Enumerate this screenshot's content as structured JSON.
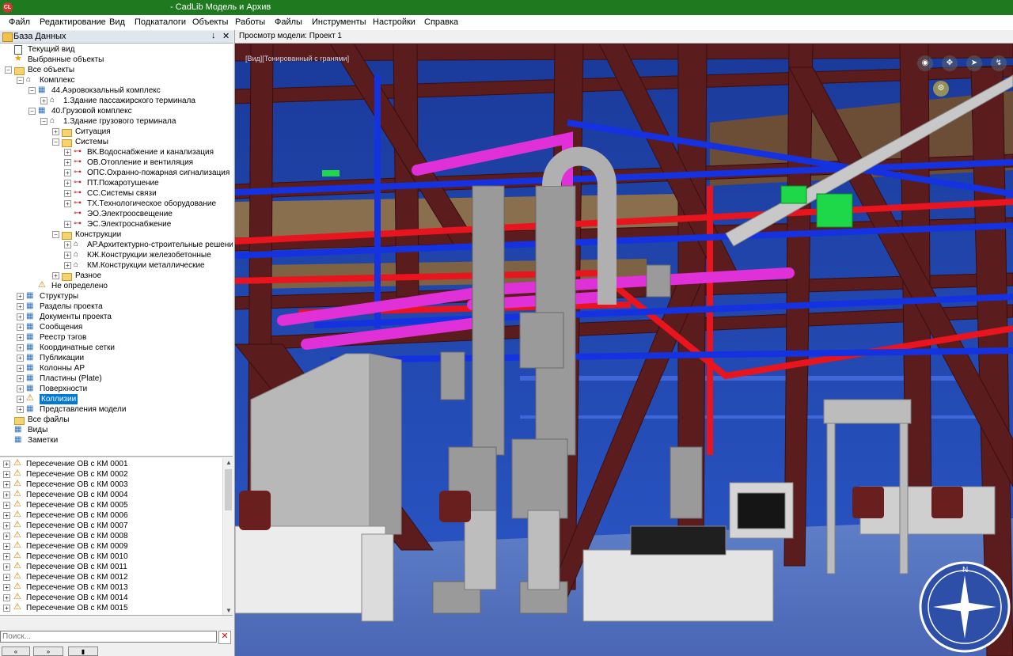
{
  "titlebar": {
    "icon_text": "CL",
    "title": "- CadLib Модель и Архив"
  },
  "menu": [
    "Файл",
    "Редактирование",
    "Вид",
    "Подкаталоги",
    "Объекты",
    "Работы",
    "Файлы",
    "Инструменты",
    "Настройки",
    "Справка"
  ],
  "panel": {
    "title": "База Данных",
    "pin": "↓",
    "close": "✕"
  },
  "tree": [
    {
      "label": "Текущий вид",
      "indent": 0,
      "expander": "",
      "icon": "doc"
    },
    {
      "label": "Выбранные объекты",
      "indent": 0,
      "expander": "",
      "icon": "star"
    },
    {
      "label": "Все объекты",
      "indent": 0,
      "expander": "−",
      "icon": "folder"
    },
    {
      "label": "Комплекс",
      "indent": 1,
      "expander": "−",
      "icon": "bld"
    },
    {
      "label": "44.Аэровокзальный комплекс",
      "indent": 2,
      "expander": "−",
      "icon": "gen"
    },
    {
      "label": "1.Здание пассажирского терминала",
      "indent": 3,
      "expander": "+",
      "icon": "bld"
    },
    {
      "label": "40.Грузовой комплекс",
      "indent": 2,
      "expander": "−",
      "icon": "gen"
    },
    {
      "label": "1.Здание грузового терминала",
      "indent": 3,
      "expander": "−",
      "icon": "bld"
    },
    {
      "label": "Ситуация",
      "indent": 4,
      "expander": "+",
      "icon": "folder"
    },
    {
      "label": "Системы",
      "indent": 4,
      "expander": "−",
      "icon": "folder"
    },
    {
      "label": "ВК.Водоснабжение и канализация",
      "indent": 5,
      "expander": "+",
      "icon": "sys"
    },
    {
      "label": "ОВ.Отопление и вентиляция",
      "indent": 5,
      "expander": "+",
      "icon": "sys"
    },
    {
      "label": "ОПС.Охранно-пожарная сигнализация",
      "indent": 5,
      "expander": "+",
      "icon": "sys"
    },
    {
      "label": "ПТ.Пожаротушение",
      "indent": 5,
      "expander": "+",
      "icon": "sys"
    },
    {
      "label": "СС.Системы связи",
      "indent": 5,
      "expander": "+",
      "icon": "sys"
    },
    {
      "label": "ТХ.Технологическое оборудование",
      "indent": 5,
      "expander": "+",
      "icon": "sys"
    },
    {
      "label": "ЭО.Электроосвещение",
      "indent": 5,
      "expander": "",
      "icon": "sys"
    },
    {
      "label": "ЭС.Электроснабжение",
      "indent": 5,
      "expander": "+",
      "icon": "sys"
    },
    {
      "label": "Конструкции",
      "indent": 4,
      "expander": "−",
      "icon": "folder"
    },
    {
      "label": "АР.Архитектурно-строительные решения",
      "indent": 5,
      "expander": "+",
      "icon": "bld"
    },
    {
      "label": "КЖ.Конструкции железобетонные",
      "indent": 5,
      "expander": "+",
      "icon": "bld"
    },
    {
      "label": "КМ.Конструкции металлические",
      "indent": 5,
      "expander": "+",
      "icon": "bld"
    },
    {
      "label": "Разное",
      "indent": 4,
      "expander": "+",
      "icon": "folder"
    },
    {
      "label": "Не определено",
      "indent": 2,
      "expander": "",
      "icon": "warn"
    },
    {
      "label": "Структуры",
      "indent": 1,
      "expander": "+",
      "icon": "gen"
    },
    {
      "label": "Разделы проекта",
      "indent": 1,
      "expander": "+",
      "icon": "gen"
    },
    {
      "label": "Документы проекта",
      "indent": 1,
      "expander": "+",
      "icon": "gen"
    },
    {
      "label": "Сообщения",
      "indent": 1,
      "expander": "+",
      "icon": "gen"
    },
    {
      "label": "Реестр тэгов",
      "indent": 1,
      "expander": "+",
      "icon": "gen"
    },
    {
      "label": "Координатные сетки",
      "indent": 1,
      "expander": "+",
      "icon": "gen"
    },
    {
      "label": "Публикации",
      "indent": 1,
      "expander": "+",
      "icon": "gen"
    },
    {
      "label": "Колонны АР",
      "indent": 1,
      "expander": "+",
      "icon": "gen"
    },
    {
      "label": "Пластины (Plate)",
      "indent": 1,
      "expander": "+",
      "icon": "gen"
    },
    {
      "label": "Поверхности",
      "indent": 1,
      "expander": "+",
      "icon": "gen"
    },
    {
      "label": "Коллизии",
      "indent": 1,
      "expander": "+",
      "icon": "warn",
      "selected": true
    },
    {
      "label": "Представления модели",
      "indent": 1,
      "expander": "+",
      "icon": "gen"
    },
    {
      "label": "Все файлы",
      "indent": 0,
      "expander": "",
      "icon": "folder"
    },
    {
      "label": "Виды",
      "indent": 0,
      "expander": "",
      "icon": "gen"
    },
    {
      "label": "Заметки",
      "indent": 0,
      "expander": "",
      "icon": "gen"
    }
  ],
  "collisions": [
    "Пересечение ОВ с КМ 0001",
    "Пересечение ОВ с КМ 0002",
    "Пересечение ОВ с КМ 0003",
    "Пересечение ОВ с КМ 0004",
    "Пересечение ОВ с КМ 0005",
    "Пересечение ОВ с КМ 0006",
    "Пересечение ОВ с КМ 0007",
    "Пересечение ОВ с КМ 0008",
    "Пересечение ОВ с КМ 0009",
    "Пересечение ОВ с КМ 0010",
    "Пересечение ОВ с КМ 0011",
    "Пересечение ОВ с КМ 0012",
    "Пересечение ОВ с КМ 0013",
    "Пересечение ОВ с КМ 0014",
    "Пересечение ОВ с КМ 0015"
  ],
  "search": {
    "placeholder": "Поиск...",
    "clear": "✕"
  },
  "bottom_buttons": [
    "«",
    "»",
    "▮"
  ],
  "viewer": {
    "tab_title": "Просмотр модели: Проект 1",
    "mode_label": "[Вид][Тонированный с гранями]"
  },
  "nav_icons": [
    "orbit-icon",
    "walk-icon",
    "fly-icon",
    "look-icon"
  ],
  "colors": {
    "titlebar": "#1f7a1f",
    "selection": "#0078d7",
    "steel": "#5a1c1c",
    "pipe_red": "#e8141e",
    "duct_magenta": "#e030d8",
    "pipe_blue": "#1432e0"
  }
}
